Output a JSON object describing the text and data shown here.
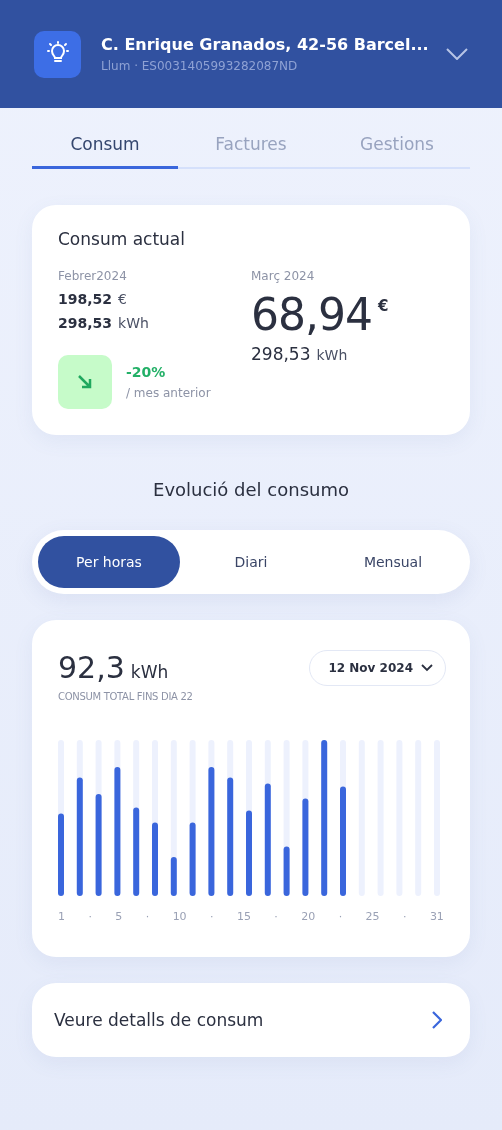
{
  "header": {
    "title": "C. Enrique Granados, 42-56 Barcel...",
    "subtitle": "Llum · ES0031405993282087ND"
  },
  "tabs": [
    {
      "label": "Consum",
      "selected": true
    },
    {
      "label": "Factures",
      "selected": false
    },
    {
      "label": "Gestions",
      "selected": false
    }
  ],
  "current": {
    "title": "Consum actual",
    "previous": {
      "period": "Febrer2024",
      "amount": "198,52",
      "currency": "€",
      "energy": "298,53",
      "energy_unit": "kWh"
    },
    "change": {
      "value": "-20%",
      "label": "/ mes anterior"
    },
    "current": {
      "period": "Març 2024",
      "amount": "68,94",
      "currency": "€",
      "energy": "298,53",
      "energy_unit": "kWh"
    }
  },
  "evolution": {
    "title": "Evolució del consumo",
    "modes": [
      {
        "label": "Per horas",
        "selected": true
      },
      {
        "label": "Diari",
        "selected": false
      },
      {
        "label": "Mensual",
        "selected": false
      }
    ]
  },
  "usage": {
    "total": "92,3",
    "unit": "kWh",
    "caption": "CONSUM TOTAL FINS DIA 22",
    "date": "12 Nov 2024",
    "x_labels": [
      "1",
      "·",
      "5",
      "·",
      "10",
      "·",
      "15",
      "·",
      "20",
      "·",
      "25",
      "·",
      "31"
    ]
  },
  "details_link": "Veure detalls de consum"
}
